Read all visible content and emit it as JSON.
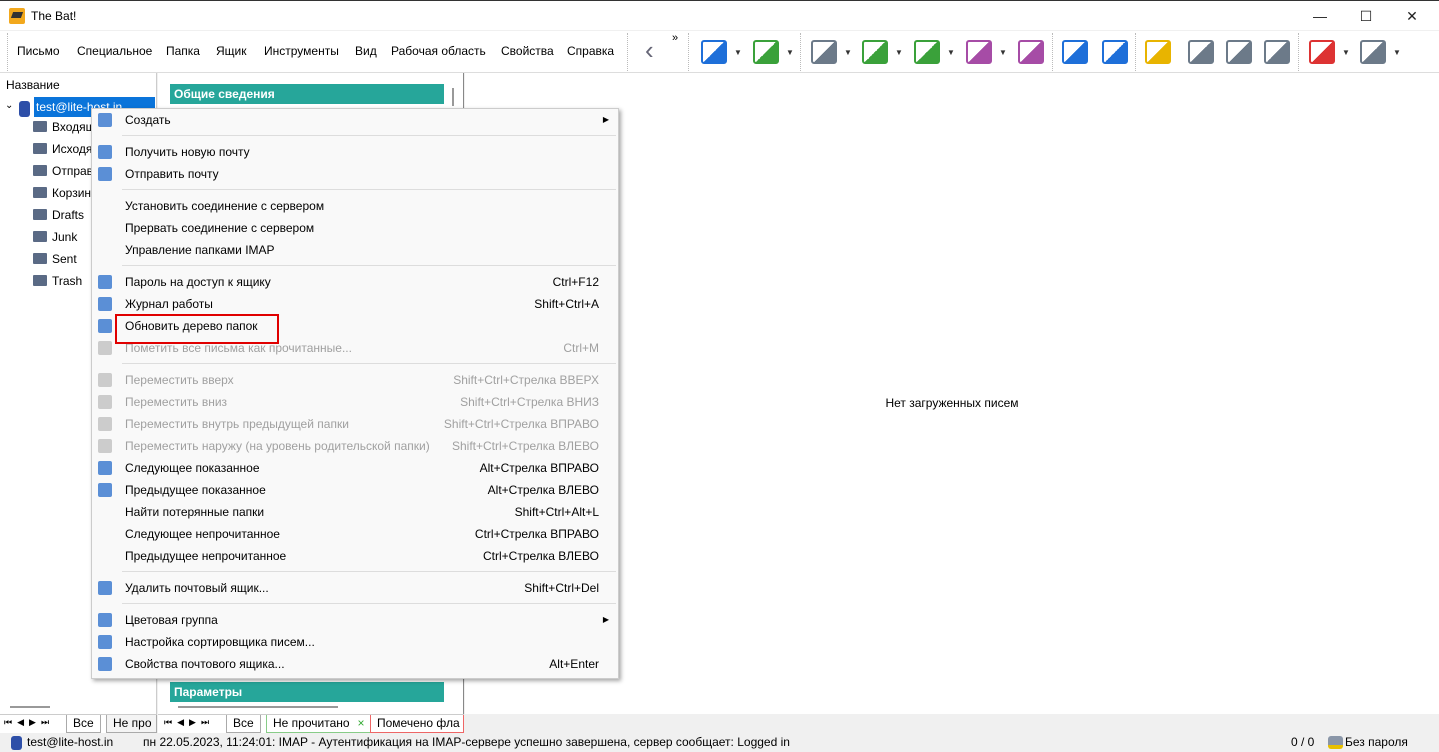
{
  "window": {
    "title": "The Bat!",
    "controls": [
      "—",
      "☐",
      "✕"
    ]
  },
  "menubar": [
    "Письмо",
    "Специальное",
    "Папка",
    "Ящик",
    "Инструменты",
    "Вид",
    "Рабочая область",
    "Свойства",
    "Справка"
  ],
  "toolbar": {
    "overflow": "»",
    "colors": {
      "blue": "#1e6fd9",
      "green": "#3aa13a",
      "purple": "#a64ca6",
      "gray": "#6c7a89"
    }
  },
  "folders": {
    "header": "Название",
    "account": "test@lite-host.in",
    "items": [
      "Входящ",
      "Исходя",
      "Отправ",
      "Корзин",
      "Drafts",
      "Junk",
      "Sent",
      "Trash"
    ]
  },
  "info": {
    "general": "Общие сведения",
    "params": "Параметры"
  },
  "messages": {
    "empty": "Нет загруженных писем"
  },
  "tabs_left": [
    "Все",
    "Не про"
  ],
  "tabs_mid": [
    "Все",
    "Не прочитано",
    "Помечено фла"
  ],
  "tab_close": "×",
  "nav": [
    "⏮",
    "◀",
    "▶",
    "⏭"
  ],
  "context_menu": [
    {
      "label": "Создать",
      "submenu": true,
      "icon": "create-icon"
    },
    {
      "sep": true
    },
    {
      "label": "Получить новую почту",
      "icon": "receive-icon"
    },
    {
      "label": "Отправить почту",
      "icon": "send-icon"
    },
    {
      "sep": true
    },
    {
      "label": "Установить соединение с сервером"
    },
    {
      "label": "Прервать соединение с сервером"
    },
    {
      "label": "Управление папками IMAP"
    },
    {
      "sep": true
    },
    {
      "label": "Пароль на доступ к ящику",
      "shortcut": "Ctrl+F12",
      "icon": "lock-icon"
    },
    {
      "label": "Журнал работы",
      "shortcut": "Shift+Ctrl+A",
      "icon": "log-icon"
    },
    {
      "label": "Обновить дерево папок",
      "icon": "refresh-icon",
      "highlighted": true
    },
    {
      "label": "Пометить все письма как прочитанные...",
      "shortcut": "Ctrl+M",
      "disabled": true,
      "icon": "mark-read-icon"
    },
    {
      "sep": true
    },
    {
      "label": "Переместить вверх",
      "shortcut": "Shift+Ctrl+Стрелка ВВЕРХ",
      "disabled": true,
      "icon": "arrow-up-icon"
    },
    {
      "label": "Переместить вниз",
      "shortcut": "Shift+Ctrl+Стрелка ВНИЗ",
      "disabled": true,
      "icon": "arrow-down-icon"
    },
    {
      "label": "Переместить внутрь предыдущей папки",
      "shortcut": "Shift+Ctrl+Стрелка ВПРАВО",
      "disabled": true,
      "icon": "arrow-right-icon"
    },
    {
      "label": "Переместить наружу (на уровень родительской папки)",
      "shortcut": "Shift+Ctrl+Стрелка ВЛЕВО",
      "disabled": true,
      "icon": "arrow-left-icon"
    },
    {
      "label": "Следующее показанное",
      "shortcut": "Alt+Стрелка ВПРАВО",
      "icon": "next-icon"
    },
    {
      "label": "Предыдущее показанное",
      "shortcut": "Alt+Стрелка ВЛЕВО",
      "icon": "prev-icon"
    },
    {
      "label": "Найти потерянные папки",
      "shortcut": "Shift+Ctrl+Alt+L"
    },
    {
      "label": "Следующее непрочитанное",
      "shortcut": "Ctrl+Стрелка ВПРАВО"
    },
    {
      "label": "Предыдущее непрочитанное",
      "shortcut": "Ctrl+Стрелка ВЛЕВО"
    },
    {
      "sep": true
    },
    {
      "label": "Удалить почтовый ящик...",
      "shortcut": "Shift+Ctrl+Del",
      "icon": "delete-icon"
    },
    {
      "sep": true
    },
    {
      "label": "Цветовая группа",
      "submenu": true,
      "icon": "color-group-icon"
    },
    {
      "label": "Настройка сортировщика писем...",
      "icon": "sorter-icon"
    },
    {
      "label": "Свойства почтового ящика...",
      "shortcut": "Alt+Enter",
      "icon": "properties-icon"
    }
  ],
  "status": {
    "account": "test@lite-host.in",
    "log": "пн 22.05.2023, 11:24:01: IMAP  - Аутентификация на IMAP-сервере успешно завершена, сервер сообщает: Logged in",
    "count": "0 / 0",
    "password": "Без пароля"
  }
}
